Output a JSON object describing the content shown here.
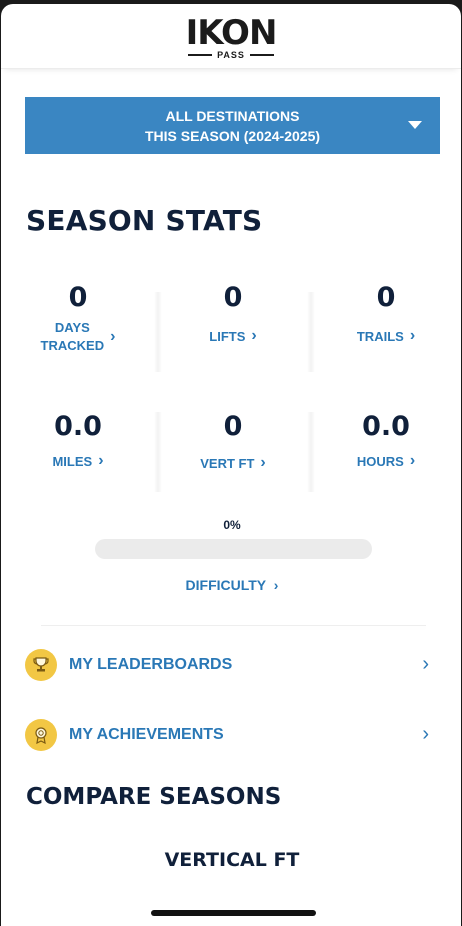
{
  "logo": {
    "word": "IKON",
    "sub": "PASS"
  },
  "destination": {
    "line1": "ALL DESTINATIONS",
    "line2": "THIS SEASON (2024-2025)"
  },
  "season_stats": {
    "title": "SEASON STATS",
    "row1": [
      {
        "value": "0",
        "label_l1": "DAYS",
        "label_l2": "TRACKED"
      },
      {
        "value": "0",
        "label": "LIFTS"
      },
      {
        "value": "0",
        "label": "TRAILS"
      }
    ],
    "row2": [
      {
        "value": "0.0",
        "label": "MILES"
      },
      {
        "value": "0",
        "label": "VERT FT"
      },
      {
        "value": "0.0",
        "label": "HOURS"
      }
    ]
  },
  "difficulty": {
    "percent_text": "0%",
    "progress": 0,
    "label": "DIFFICULTY"
  },
  "links": {
    "leaderboards": "MY LEADERBOARDS",
    "achievements": "MY ACHIEVEMENTS"
  },
  "compare": {
    "title": "COMPARE SEASONS",
    "metric": "VERTICAL FT"
  },
  "icons": {
    "chevron": "chevron-right-icon",
    "dropdown": "caret-down-icon",
    "trophy": "trophy-icon",
    "medal": "medal-icon"
  },
  "colors": {
    "accent": "#3a86c2",
    "link": "#2a78b6",
    "dark": "#10203a",
    "badge": "#f2c744"
  }
}
